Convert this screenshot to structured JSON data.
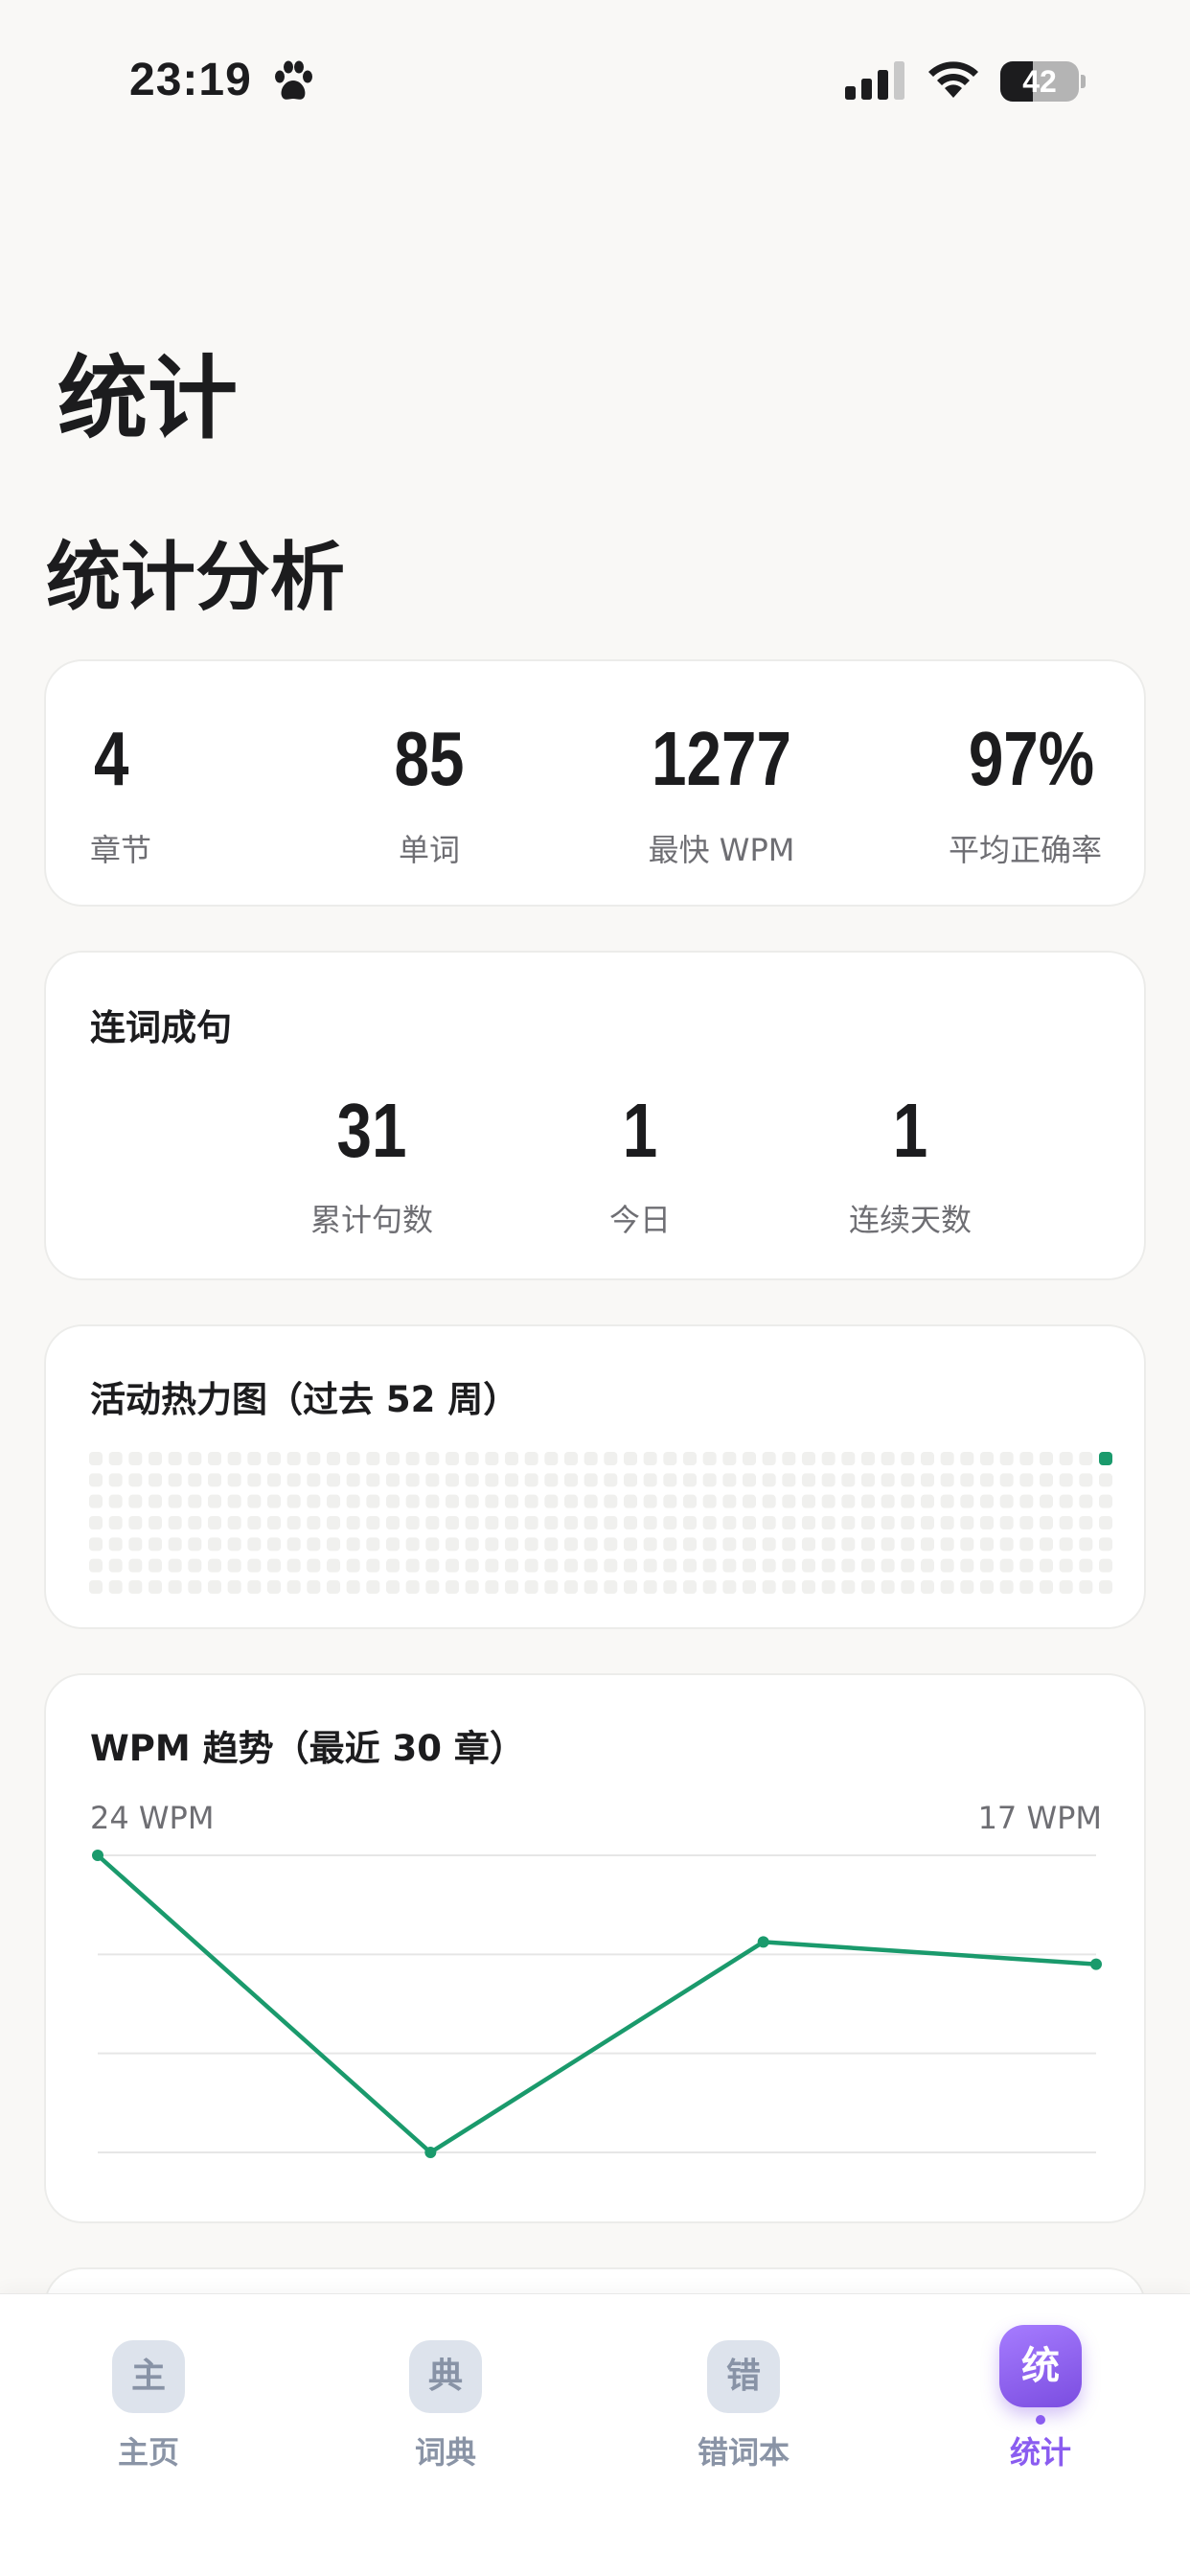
{
  "status_bar": {
    "time": "23:19",
    "battery": "42",
    "battery_level": 0.42
  },
  "page": {
    "title": "统计",
    "section_title": "统计分析"
  },
  "summary": [
    {
      "value": "4",
      "label": "章节"
    },
    {
      "value": "85",
      "label": "单词"
    },
    {
      "value": "1277",
      "label": "最快 WPM"
    },
    {
      "value": "97%",
      "label": "平均正确率"
    }
  ],
  "sentences": {
    "title": "连词成句",
    "items": [
      {
        "value": "31",
        "label": "累计句数"
      },
      {
        "value": "1",
        "label": "今日"
      },
      {
        "value": "1",
        "label": "连续天数"
      }
    ]
  },
  "heatmap": {
    "title": "活动热力图（过去 52 周）",
    "weeks": 52,
    "days": 7,
    "active_cells": [
      [
        51,
        0
      ]
    ],
    "colors": {
      "empty": "#f0f0ee",
      "active": "#1a9a6c"
    }
  },
  "chart_data": {
    "type": "line",
    "title": "WPM 趋势（最近 30 章）",
    "max_label": "24 WPM",
    "min_label": "17 WPM",
    "x": [
      1,
      2,
      3,
      4
    ],
    "values": [
      24,
      18,
      22.25,
      21.8
    ],
    "ylim": [
      18,
      24
    ],
    "grid": true,
    "color": "#1a9a6c"
  },
  "tab_bar": {
    "tabs": [
      {
        "icon": "主",
        "label": "主页",
        "active": false
      },
      {
        "icon": "典",
        "label": "词典",
        "active": false
      },
      {
        "icon": "错",
        "label": "错词本",
        "active": false
      },
      {
        "icon": "统",
        "label": "统计",
        "active": true
      }
    ]
  }
}
